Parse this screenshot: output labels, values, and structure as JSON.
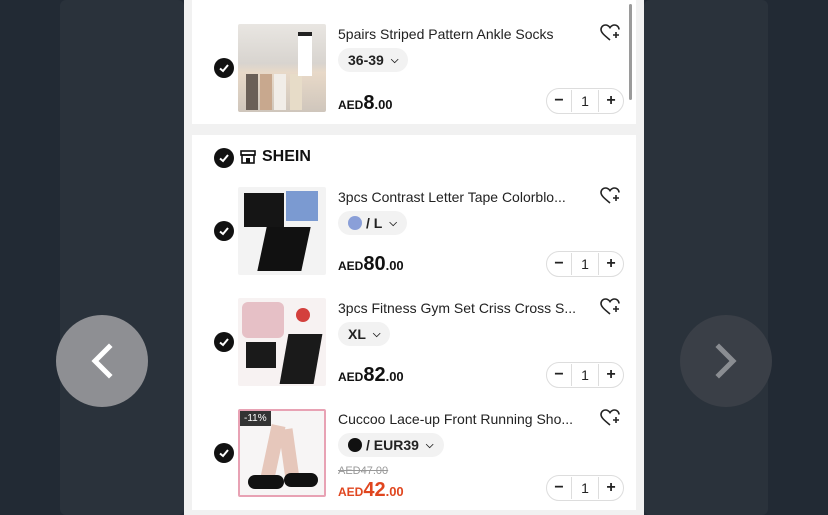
{
  "items_top": {
    "title": "5pairs Striped Pattern Ankle Socks",
    "variant": "36-39",
    "price_currency": "AED",
    "price_int": "8",
    "price_dec": ".00",
    "quantity": "1"
  },
  "store": {
    "name": "SHEIN"
  },
  "items": [
    {
      "title": "3pcs Contrast Letter Tape Colorblo...",
      "variant": "/ L",
      "swatch_color": "#8a9fd8",
      "price_currency": "AED",
      "price_int": "80",
      "price_dec": ".00",
      "quantity": "1"
    },
    {
      "title": "3pcs Fitness Gym Set Criss Cross S...",
      "variant": "XL",
      "price_currency": "AED",
      "price_int": "82",
      "price_dec": ".00",
      "quantity": "1"
    },
    {
      "title": "Cuccoo Lace-up Front Running Sho...",
      "variant": "/ EUR39",
      "swatch_color": "#111111",
      "discount": "-11%",
      "old_price": "AED47.00",
      "price_currency": "AED",
      "price_int": "42",
      "price_dec": ".00",
      "quantity": "1"
    }
  ],
  "stepper": {
    "minus": "−",
    "plus": "+"
  },
  "colors": {
    "sale_red": "#e0461f",
    "checkbox": "#111111",
    "arrow_active": "#8e8f93",
    "arrow_inactive": "#3a3f47"
  },
  "icons": {
    "prev": "chevron-left-icon",
    "next": "chevron-right-icon",
    "wishlist": "heart-plus-icon",
    "store": "store-icon",
    "check": "check-icon"
  }
}
